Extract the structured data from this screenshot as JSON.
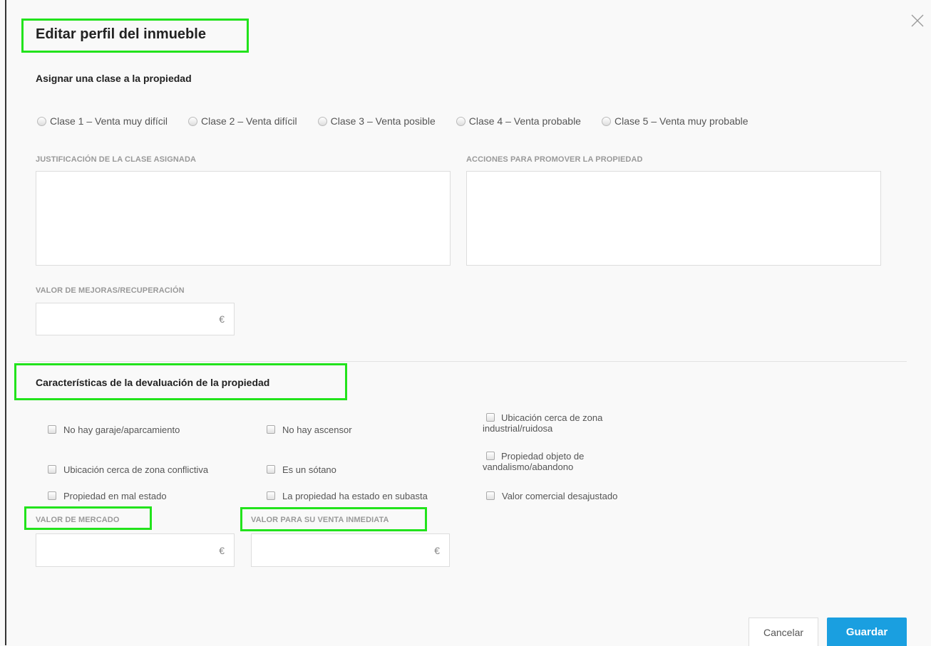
{
  "modal": {
    "title": "Editar perfil del inmueble",
    "close_icon": "close-icon"
  },
  "clase": {
    "title": "Asignar una clase a la propiedad",
    "options": [
      "Clase 1 – Venta muy difícil",
      "Clase 2 – Venta difícil",
      "Clase 3 – Venta posible",
      "Clase 4 – Venta probable",
      "Clase 5 – Venta muy probable"
    ],
    "selected": null
  },
  "fields": {
    "justificacion_label": "JUSTIFICACIÓN DE LA CLASE ASIGNADA",
    "justificacion_value": "",
    "acciones_label": "ACCIONES PARA PROMOVER LA PROPIEDAD",
    "acciones_value": "",
    "mejoras_label": "VALOR DE MEJORAS/RECUPERACIÓN",
    "mejoras_value": "",
    "mercado_label": "VALOR DE MERCADO",
    "mercado_value": "",
    "venta_inmediata_label": "VALOR PARA SU VENTA INMEDIATA",
    "venta_inmediata_value": "",
    "currency_symbol": "€"
  },
  "devaluacion": {
    "title": "Características de la devaluación de la propiedad",
    "checkboxes": {
      "no_garaje": "No hay garaje/aparcamiento",
      "no_ascensor": "No hay ascensor",
      "zona_industrial_l1": "Ubicación cerca de zona",
      "zona_industrial_l2": "industrial/ruidosa",
      "zona_conflictiva": "Ubicación cerca de zona conflictiva",
      "sotano": "Es un sótano",
      "vandalismo_l1": "Propiedad objeto de",
      "vandalismo_l2": "vandalismo/abandono",
      "mal_estado": "Propiedad en mal estado",
      "subasta": "La propiedad ha estado en subasta",
      "valor_desajustado": "Valor comercial desajustado"
    }
  },
  "actions": {
    "cancel_label": "Cancelar",
    "save_label": "Guardar"
  },
  "colors": {
    "primary": "#1a9fe0",
    "highlight": "#22e31c"
  }
}
